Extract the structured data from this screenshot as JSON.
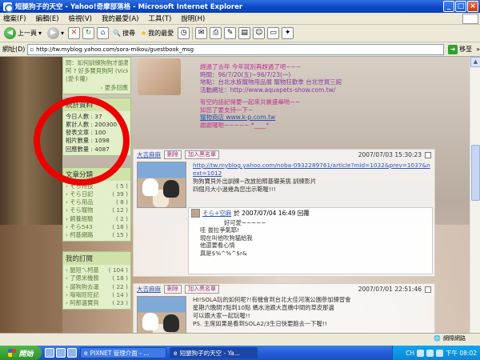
{
  "window": {
    "title": "短腿狗子的天空 - Yahoo!奇摩部落格 - Microsoft Internet Explorer",
    "buttons": [
      "_",
      "□",
      "×"
    ]
  },
  "menu": [
    "檔案(F)",
    "編輯(E)",
    "檢視(V)",
    "我的最愛(A)",
    "工具(T)",
    "說明(H)"
  ],
  "toolbar": {
    "back_label": "上一頁",
    "search_label": "搜尋",
    "favorites_label": "我的最愛"
  },
  "address": {
    "label": "網址(D)",
    "url": "http://tw.myblog.yahoo.com/sora-mikou/guestbook_msg",
    "go_label": "移至"
  },
  "sidebar": {
    "top_links": [
      "問：如何訓練狗狗才能教好牠？...",
      "阿 ? 好多寶貝狗阿 (Vicky)",
      "(愛卡蘿)"
    ],
    "top_more": "› 更多回應",
    "stats": {
      "title": "統計資料",
      "rows": [
        {
          "label": "今日人數",
          "value": "37"
        },
        {
          "label": "累計人數",
          "value": "200300"
        },
        {
          "label": "發表文章",
          "value": "100"
        },
        {
          "label": "相片數量",
          "value": "1098"
        },
        {
          "label": "回應數量",
          "value": "4087"
        }
      ]
    },
    "categories": {
      "title": "文章分類",
      "items": [
        {
          "name": "そら特技",
          "count": "( 5 )"
        },
        {
          "name": "そら日記",
          "count": "( 39 )"
        },
        {
          "name": "そら用品",
          "count": "( 8 )"
        },
        {
          "name": "そら寵物",
          "count": "( 12 )"
        },
        {
          "name": "飼養經驗",
          "count": "( 2 )"
        },
        {
          "name": "そら543",
          "count": "( 18 )"
        },
        {
          "name": "柯基網路",
          "count": "( 15 )"
        }
      ]
    },
    "subscriptions": {
      "title": "我的訂閱",
      "items": [
        {
          "name": "腿短ㄟ柯基",
          "count": "( 104 )"
        },
        {
          "name": "了偲米機務",
          "count": "( 18 )"
        },
        {
          "name": "遛狗狗去運",
          "count": "( 22 )"
        },
        {
          "name": "嗡嗡旺旺記",
          "count": "( 14 )"
        },
        {
          "name": "阿那邊寶貝",
          "count": "( 23 )"
        }
      ]
    }
  },
  "post": {
    "lines": [
      "趕過了去年  今年就別再趕過了吧~~~",
      "時間：96/7/20(五)~96/7/23(一)",
      "地點：台北水族寵物用品展 寵物狂歡季 台北世貿三館",
      "活動網址：http://www.aquapets-show.com.tw/",
      "",
      "有空的話記得要一起來共襄盛舉喲~~",
      "如您了要支持一下~",
      "寵物商店 www.k-p.com.tw",
      "謝謝囉喲~~~~~ *____*"
    ]
  },
  "entries": [
    {
      "name": "大吉麻麻",
      "btn_delete": "刪除",
      "btn_blacklist": "加入黑名單",
      "date": "2007/07/03 15:30:23",
      "text": [
        "http://tw.myblog.yahoo.com/noba-0932289761/article?mid=1032&prev=1037&next=1012",
        "狗狗寶貝外出訓練~改放拍照基礎美挑  訓練影片",
        "四個月大小過幾為您出示範喔!!!"
      ],
      "reply": {
        "name": "そら+空麻",
        "meta": "於 2007/07/04 16:49 回覆",
        "lines": [
          "好可愛~~~~~",
          "哇 拔拉爭氣耶!",
          "現在叫他吹狗貓給我",
          "他還要看心情",
          "真是$%^%^$r&"
        ]
      }
    },
    {
      "name": "大吉麻麻",
      "btn_delete": "刪除",
      "btn_blacklist": "加入黑名單",
      "date": "2007/07/01 22:51:46",
      "text": [
        "HI!SOLA玩的如何呢?!有機會到台北大佳河濱公園參加練習會",
        "星期六晚間7點到10點  螞水池跟大直橋中間的草皮那邊",
        "可以跟大家一起玩喔!!",
        "PS. 主席如果是看到SOLA2/3生日快要跑去一下喔!!"
      ]
    }
  ],
  "status": {
    "text": "",
    "zone": "網際網路"
  },
  "taskbar": {
    "start": "開始",
    "tasks": [
      "PIXNET 管理介面 - ...",
      "短腿狗子的天空 - Ya..."
    ],
    "lang": "CH",
    "clock": "下午 08:02"
  }
}
